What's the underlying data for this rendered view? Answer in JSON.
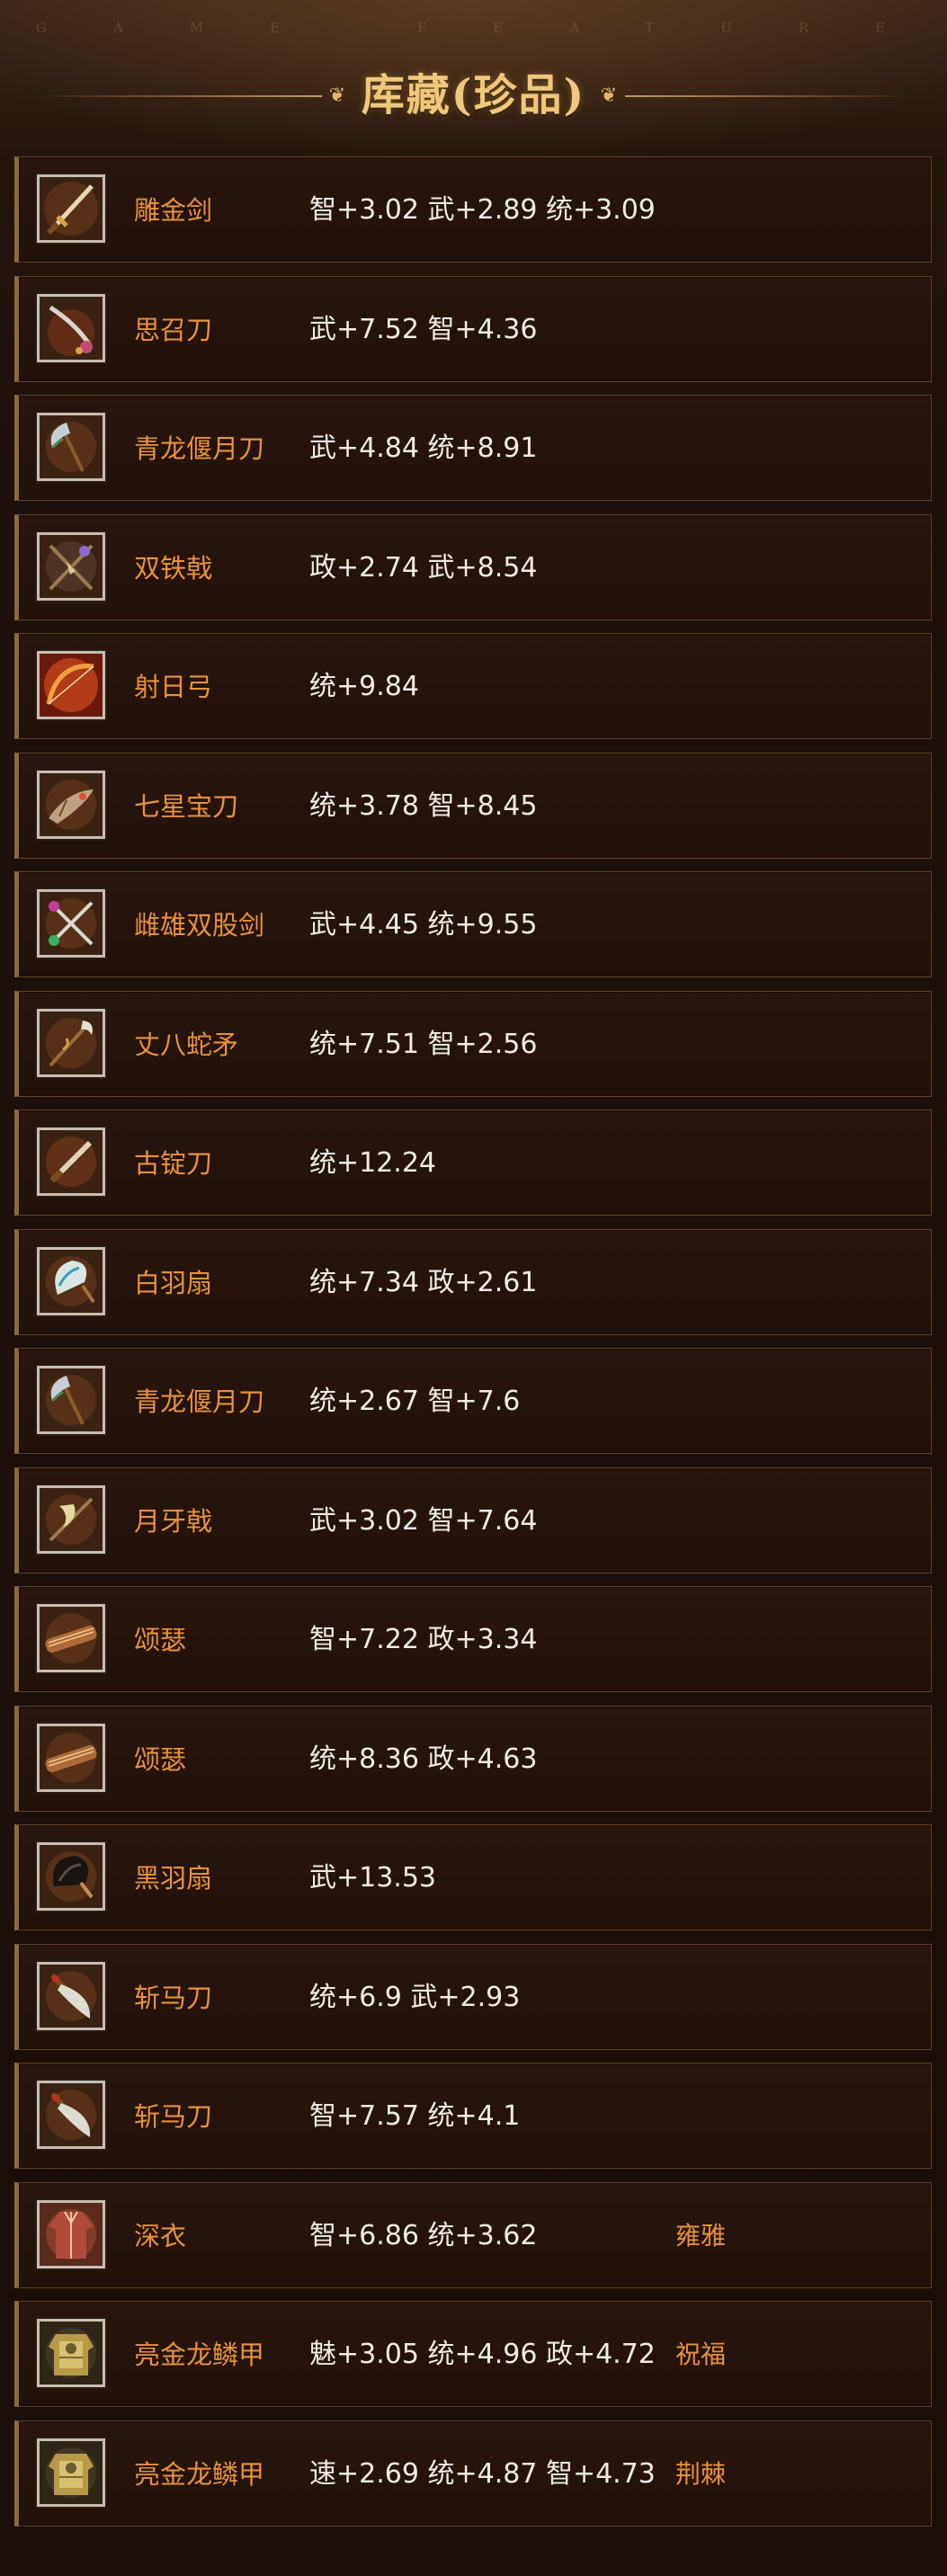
{
  "header": {
    "watermark": "GAME FEATURES",
    "title": "库藏(珍品)",
    "ornament_left": "❦",
    "ornament_right": "❦"
  },
  "colors": {
    "name": "#e8913e",
    "stats": "#f1ece4",
    "title": "#f1c77c"
  },
  "items": [
    {
      "name": "雕金剑",
      "stats": "智+3.02 武+2.89 统+3.09",
      "tag": "",
      "icon": "sword-icon"
    },
    {
      "name": "思召刀",
      "stats": "武+7.52 智+4.36",
      "tag": "",
      "icon": "saber-icon"
    },
    {
      "name": "青龙偃月刀",
      "stats": "武+4.84 统+8.91",
      "tag": "",
      "icon": "glaive-icon"
    },
    {
      "name": "双铁戟",
      "stats": "政+2.74 武+8.54",
      "tag": "",
      "icon": "twin-halberd-icon"
    },
    {
      "name": "射日弓",
      "stats": "统+9.84",
      "tag": "",
      "icon": "bow-icon"
    },
    {
      "name": "七星宝刀",
      "stats": "统+3.78 智+8.45",
      "tag": "",
      "icon": "dragon-blade-icon"
    },
    {
      "name": "雌雄双股剑",
      "stats": "武+4.45 统+9.55",
      "tag": "",
      "icon": "twin-swords-icon"
    },
    {
      "name": "丈八蛇矛",
      "stats": "统+7.51 智+2.56",
      "tag": "",
      "icon": "serpent-spear-icon"
    },
    {
      "name": "古锭刀",
      "stats": "统+12.24",
      "tag": "",
      "icon": "blade-icon"
    },
    {
      "name": "白羽扇",
      "stats": "统+7.34 政+2.61",
      "tag": "",
      "icon": "white-fan-icon"
    },
    {
      "name": "青龙偃月刀",
      "stats": "统+2.67 智+7.6",
      "tag": "",
      "icon": "glaive-icon"
    },
    {
      "name": "月牙戟",
      "stats": "武+3.02 智+7.64",
      "tag": "",
      "icon": "crescent-halberd-icon"
    },
    {
      "name": "颂瑟",
      "stats": "智+7.22 政+3.34",
      "tag": "",
      "icon": "zither-icon"
    },
    {
      "name": "颂瑟",
      "stats": "统+8.36 政+4.63",
      "tag": "",
      "icon": "zither-icon"
    },
    {
      "name": "黑羽扇",
      "stats": "武+13.53",
      "tag": "",
      "icon": "black-fan-icon"
    },
    {
      "name": "斩马刀",
      "stats": "统+6.9 武+2.93",
      "tag": "",
      "icon": "broadsword-icon"
    },
    {
      "name": "斩马刀",
      "stats": "智+7.57 统+4.1",
      "tag": "",
      "icon": "broadsword-icon"
    },
    {
      "name": "深衣",
      "stats": "智+6.86 统+3.62",
      "tag": "雍雅",
      "icon": "robe-icon"
    },
    {
      "name": "亮金龙鳞甲",
      "stats": "魅+3.05 统+4.96 政+4.72",
      "tag": "祝福",
      "icon": "armor-icon"
    },
    {
      "name": "亮金龙鳞甲",
      "stats": "速+2.69 统+4.87 智+4.73",
      "tag": "荆棘",
      "icon": "armor-icon"
    }
  ]
}
